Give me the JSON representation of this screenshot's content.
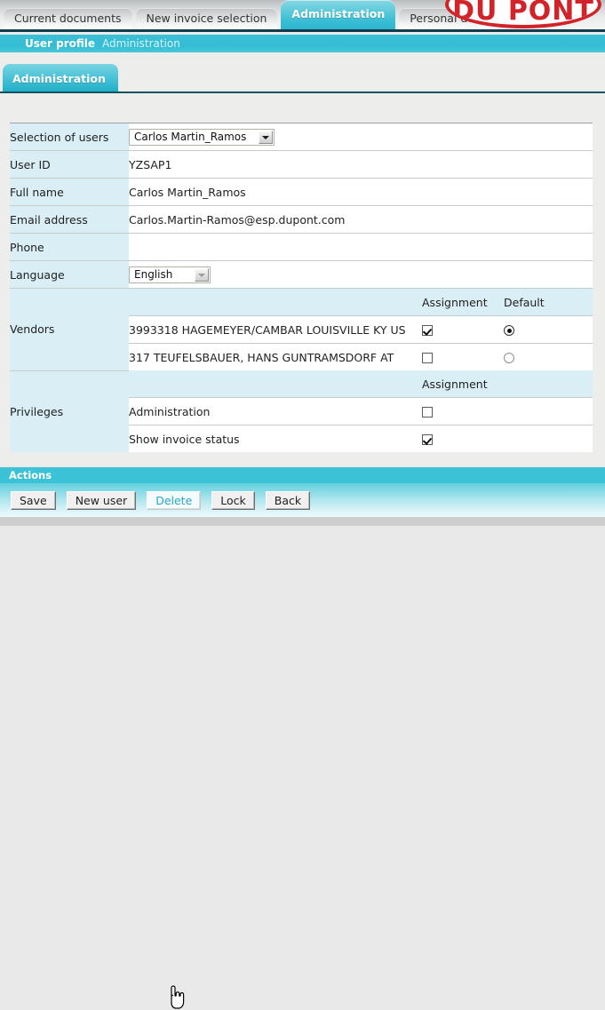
{
  "tabs": [
    {
      "label": "Current documents",
      "active": false
    },
    {
      "label": "New invoice selection",
      "active": false
    },
    {
      "label": "Administration",
      "active": true
    },
    {
      "label": "Personal data",
      "active": false
    }
  ],
  "logo": {
    "text": "DU PONT",
    "registered": "®"
  },
  "breadcrumb": {
    "main": "User profile",
    "sub": "Administration"
  },
  "section": {
    "tab_label": "Administration"
  },
  "form": {
    "rows": [
      {
        "label": "Selection of users",
        "value": "Carlos Martin_Ramos",
        "control": "select-wide"
      },
      {
        "label": "User ID",
        "value": "YZSAP1",
        "control": "text"
      },
      {
        "label": "Full name",
        "value": "Carlos Martin_Ramos",
        "control": "text"
      },
      {
        "label": "Email address",
        "value": "Carlos.Martin-Ramos@esp.dupont.com",
        "control": "text"
      },
      {
        "label": "Phone",
        "value": "",
        "control": "text"
      },
      {
        "label": "Language",
        "value": "English",
        "control": "select-narrow"
      }
    ]
  },
  "vendors": {
    "label": "Vendors",
    "columns": {
      "assignment": "Assignment",
      "default": "Default"
    },
    "items": [
      {
        "name": "3993318 HAGEMEYER/CAMBAR LOUISVILLE KY US",
        "assigned": true,
        "is_default": true
      },
      {
        "name": "317 TEUFELSBAUER, HANS GUNTRAMSDORF AT",
        "assigned": false,
        "is_default": false
      }
    ]
  },
  "privileges": {
    "label": "Privileges",
    "columns": {
      "assignment": "Assignment"
    },
    "items": [
      {
        "name": "Administration",
        "assigned": false
      },
      {
        "name": "Show invoice status",
        "assigned": true
      }
    ]
  },
  "actions": {
    "title": "Actions",
    "buttons": [
      {
        "label": "Save",
        "hover": false
      },
      {
        "label": "New user",
        "hover": false
      },
      {
        "label": "Delete",
        "hover": true
      },
      {
        "label": "Lock",
        "hover": false
      },
      {
        "label": "Back",
        "hover": false
      }
    ]
  },
  "colors": {
    "accent_teal": "#34bcd3",
    "label_blue": "#d9eef5",
    "brand_red": "#d2232a",
    "hover_text": "#27a7c2"
  }
}
